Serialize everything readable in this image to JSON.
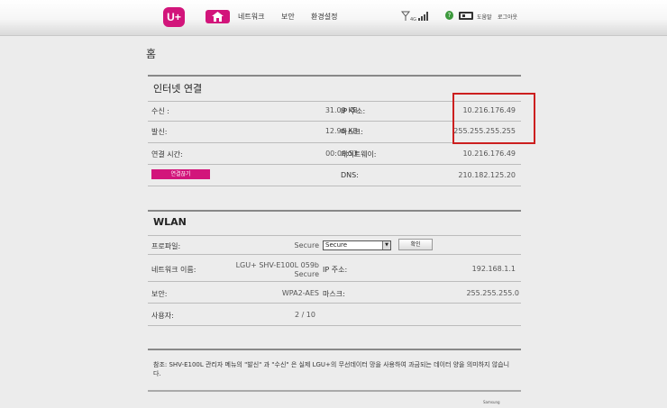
{
  "header": {
    "logo": "U+",
    "nav": [
      "네트워크",
      "보안",
      "환경설정"
    ],
    "network_type": "4G",
    "help_label": "도움말",
    "logout_label": "로그아웃"
  },
  "page_title": "홈",
  "internet": {
    "title": "인터넷 연결",
    "rows": [
      {
        "label": "수신 :",
        "value": "31.09 KB",
        "label2": "IP 주소:",
        "value2": "10.216.176.49"
      },
      {
        "label": "발신:",
        "value": "12.96 KB",
        "label2": "마스크:",
        "value2": "255.255.255.255"
      },
      {
        "label": "연결 시간:",
        "value": "00:00:53",
        "label2": "게이트웨이:",
        "value2": "10.216.176.49"
      }
    ],
    "disconnect_label": "연결끊기",
    "dns_label": "DNS:",
    "dns_value": "210.182.125.20"
  },
  "wlan": {
    "title": "WLAN",
    "profile_label": "프로파일:",
    "profile_value": "Secure",
    "profile_select": "Secure",
    "confirm_label": "확인",
    "ssid_label": "네트워크 이름:",
    "ssid_value_line1": "LGU+ SHV-E100L 059b",
    "ssid_value_line2": "Secure",
    "ip_label": "IP 주소:",
    "ip_value": "192.168.1.1",
    "security_label": "보안:",
    "security_value": "WPA2-AES",
    "mask_label": "마스크:",
    "mask_value": "255.255.255.0",
    "users_label": "사용자:",
    "users_value": "2 / 10"
  },
  "note": "참조: SHV-E100L 관리자 메뉴의 \"발신\" 과 \"수신\" 은 실제 LGU+의 무선데이터 망을 사용하여 과금되는 데이터 양을 의미하지 않습니다.",
  "footer_brand": "Samsung",
  "colors": {
    "accent": "#d2157b",
    "highlight": "#cc1f1f"
  }
}
